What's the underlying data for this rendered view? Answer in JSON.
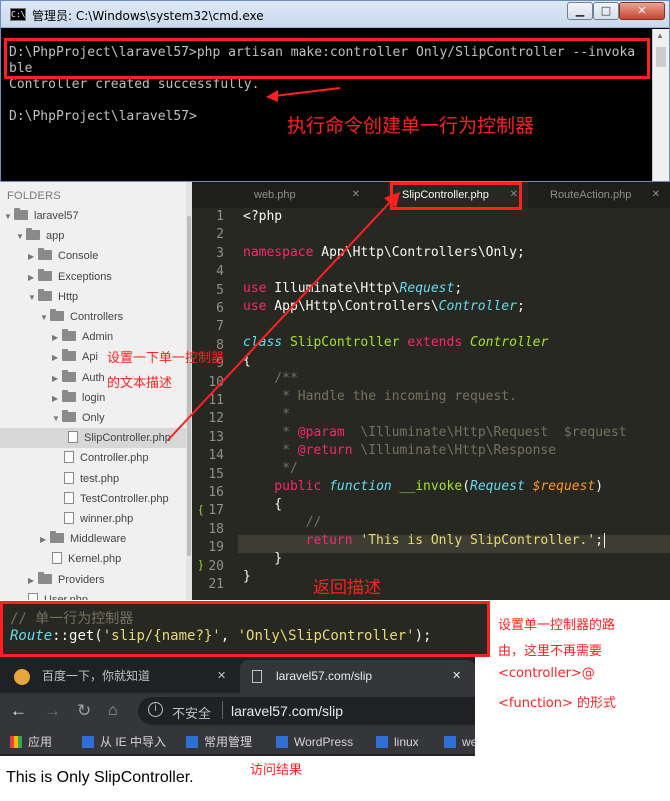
{
  "cmd": {
    "title": "管理员: C:\\Windows\\system32\\cmd.exe",
    "lines": [
      "D:\\PhpProject\\laravel57>php artisan make:controller Only/SlipController --invoka",
      "ble",
      "Controller created successfully.",
      "",
      "D:\\PhpProject\\laravel57>"
    ],
    "annotation": "执行命令创建单一行为控制器"
  },
  "sidebar": {
    "header": "FOLDERS",
    "items": [
      {
        "label": "laravel57",
        "type": "folder",
        "open": true
      },
      {
        "label": "app",
        "type": "folder",
        "open": true
      },
      {
        "label": "Console",
        "type": "folder",
        "open": false
      },
      {
        "label": "Exceptions",
        "type": "folder",
        "open": false
      },
      {
        "label": "Http",
        "type": "folder",
        "open": true
      },
      {
        "label": "Controllers",
        "type": "folder",
        "open": true
      },
      {
        "label": "Admin",
        "type": "folder",
        "open": false
      },
      {
        "label": "Api",
        "type": "folder",
        "open": false
      },
      {
        "label": "Auth",
        "type": "folder",
        "open": false
      },
      {
        "label": "login",
        "type": "folder",
        "open": false
      },
      {
        "label": "Only",
        "type": "folder",
        "open": true
      },
      {
        "label": "SlipController.php",
        "type": "file",
        "selected": true
      },
      {
        "label": "Controller.php",
        "type": "file"
      },
      {
        "label": "test.php",
        "type": "file"
      },
      {
        "label": "TestController.php",
        "type": "file"
      },
      {
        "label": "winner.php",
        "type": "file"
      },
      {
        "label": "Middleware",
        "type": "folder",
        "open": false
      },
      {
        "label": "Kernel.php",
        "type": "file"
      },
      {
        "label": "Providers",
        "type": "folder",
        "open": false
      },
      {
        "label": "User.php",
        "type": "file"
      }
    ]
  },
  "tabs": [
    {
      "label": "web.php",
      "close": "✕"
    },
    {
      "label": "SlipController.php",
      "close": "✕"
    },
    {
      "label": "RouteAction.php",
      "close": "✕"
    }
  ],
  "line_numbers": [
    "1",
    "2",
    "3",
    "4",
    "5",
    "6",
    "7",
    "8",
    "9",
    "10",
    "11",
    "12",
    "13",
    "14",
    "15",
    "16",
    "17",
    "18",
    "19",
    "20",
    "21"
  ],
  "code": {
    "l1": "<?php",
    "l3_kw": "namespace",
    "l3_rest": " App\\Http\\Controllers\\Only;",
    "l5_kw": "use",
    "l5_rest": " Illuminate\\Http\\",
    "l5_cls": "Request",
    "l5_end": ";",
    "l6_kw": "use",
    "l6_rest": " App\\Http\\Controllers\\",
    "l6_cls": "Controller",
    "l6_end": ";",
    "l8_kw": "class",
    "l8_name": " SlipController ",
    "l8_ext": "extends",
    "l8_parent": " Controller",
    "l9": "{",
    "l10": "    /**",
    "l11": "     * Handle the incoming request.",
    "l12": "     *",
    "l13_a": "     * ",
    "l13_tag": "@param",
    "l13_b": "  \\Illuminate\\Http\\Request  $request",
    "l14_a": "     * ",
    "l14_tag": "@return",
    "l14_b": " \\Illuminate\\Http\\Response",
    "l15": "     */",
    "l16_kw": "    public",
    "l16_fn": " function",
    "l16_name": " __invoke",
    "l16_p1": "(",
    "l16_type": "Request",
    "l16_var": " $request",
    "l16_p2": ")",
    "l17": "    {",
    "l18": "        //",
    "l19_kw": "        return",
    "l19_str": " 'This is Only SlipController.'",
    "l19_end": ";",
    "l20": "    }",
    "l21": "}"
  },
  "annotations": {
    "desc1": "设置一下单一控制器",
    "desc2": "的文本描述",
    "ret": "返回描述",
    "route1": "设置单一控制器的路",
    "route2": "由，这里不再需要",
    "route3": "<controller>@",
    "route4": "<function> 的形式",
    "result": "访问结果"
  },
  "route": {
    "comment": "// 单一行为控制器",
    "obj": "Route",
    "call": "::get(",
    "arg1": "'slip/{name?}'",
    "sep": ", ",
    "arg2": "'Only\\SlipController'",
    "end": ");"
  },
  "browser": {
    "tab1": "百度一下，你就知道",
    "tab2": "laravel57.com/slip",
    "close": "✕",
    "insecure": "不安全",
    "url": "laravel57.com/slip",
    "bookmarks": [
      "应用",
      "从 IE 中导入",
      "常用管理",
      "WordPress",
      "linux",
      "we"
    ],
    "page_text": "This is Only SlipController."
  },
  "colors": {
    "annotation": "#ff2020",
    "editor_bg": "#272822",
    "keyword": "#f92672",
    "string": "#e6db74"
  }
}
